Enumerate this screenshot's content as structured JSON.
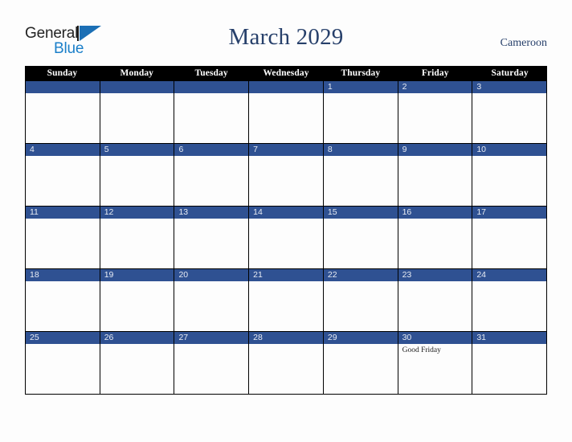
{
  "brand": {
    "name_part1": "General",
    "name_part2": "Blue",
    "triangle_icon": "triangle-icon",
    "colors": {
      "general_text": "#232323",
      "blue_text": "#1a7fc9",
      "triangle": "#1b6fb5"
    }
  },
  "header": {
    "title": "March 2029",
    "country": "Cameroon",
    "title_color": "#27406b"
  },
  "calendar": {
    "month": "March",
    "year": "2029",
    "weekday_headers": [
      "Sunday",
      "Monday",
      "Tuesday",
      "Wednesday",
      "Thursday",
      "Friday",
      "Saturday"
    ],
    "colors": {
      "header_bar": "#000000",
      "date_bar": "#2f5192",
      "date_text": "#e8ecf4",
      "cell_background": "#fdfdfd",
      "grid_line": "#000000"
    },
    "weeks": [
      [
        {
          "day": "",
          "event": ""
        },
        {
          "day": "",
          "event": ""
        },
        {
          "day": "",
          "event": ""
        },
        {
          "day": "",
          "event": ""
        },
        {
          "day": "1",
          "event": ""
        },
        {
          "day": "2",
          "event": ""
        },
        {
          "day": "3",
          "event": ""
        }
      ],
      [
        {
          "day": "4",
          "event": ""
        },
        {
          "day": "5",
          "event": ""
        },
        {
          "day": "6",
          "event": ""
        },
        {
          "day": "7",
          "event": ""
        },
        {
          "day": "8",
          "event": ""
        },
        {
          "day": "9",
          "event": ""
        },
        {
          "day": "10",
          "event": ""
        }
      ],
      [
        {
          "day": "11",
          "event": ""
        },
        {
          "day": "12",
          "event": ""
        },
        {
          "day": "13",
          "event": ""
        },
        {
          "day": "14",
          "event": ""
        },
        {
          "day": "15",
          "event": ""
        },
        {
          "day": "16",
          "event": ""
        },
        {
          "day": "17",
          "event": ""
        }
      ],
      [
        {
          "day": "18",
          "event": ""
        },
        {
          "day": "19",
          "event": ""
        },
        {
          "day": "20",
          "event": ""
        },
        {
          "day": "21",
          "event": ""
        },
        {
          "day": "22",
          "event": ""
        },
        {
          "day": "23",
          "event": ""
        },
        {
          "day": "24",
          "event": ""
        }
      ],
      [
        {
          "day": "25",
          "event": ""
        },
        {
          "day": "26",
          "event": ""
        },
        {
          "day": "27",
          "event": ""
        },
        {
          "day": "28",
          "event": ""
        },
        {
          "day": "29",
          "event": ""
        },
        {
          "day": "30",
          "event": "Good Friday"
        },
        {
          "day": "31",
          "event": ""
        }
      ]
    ]
  }
}
